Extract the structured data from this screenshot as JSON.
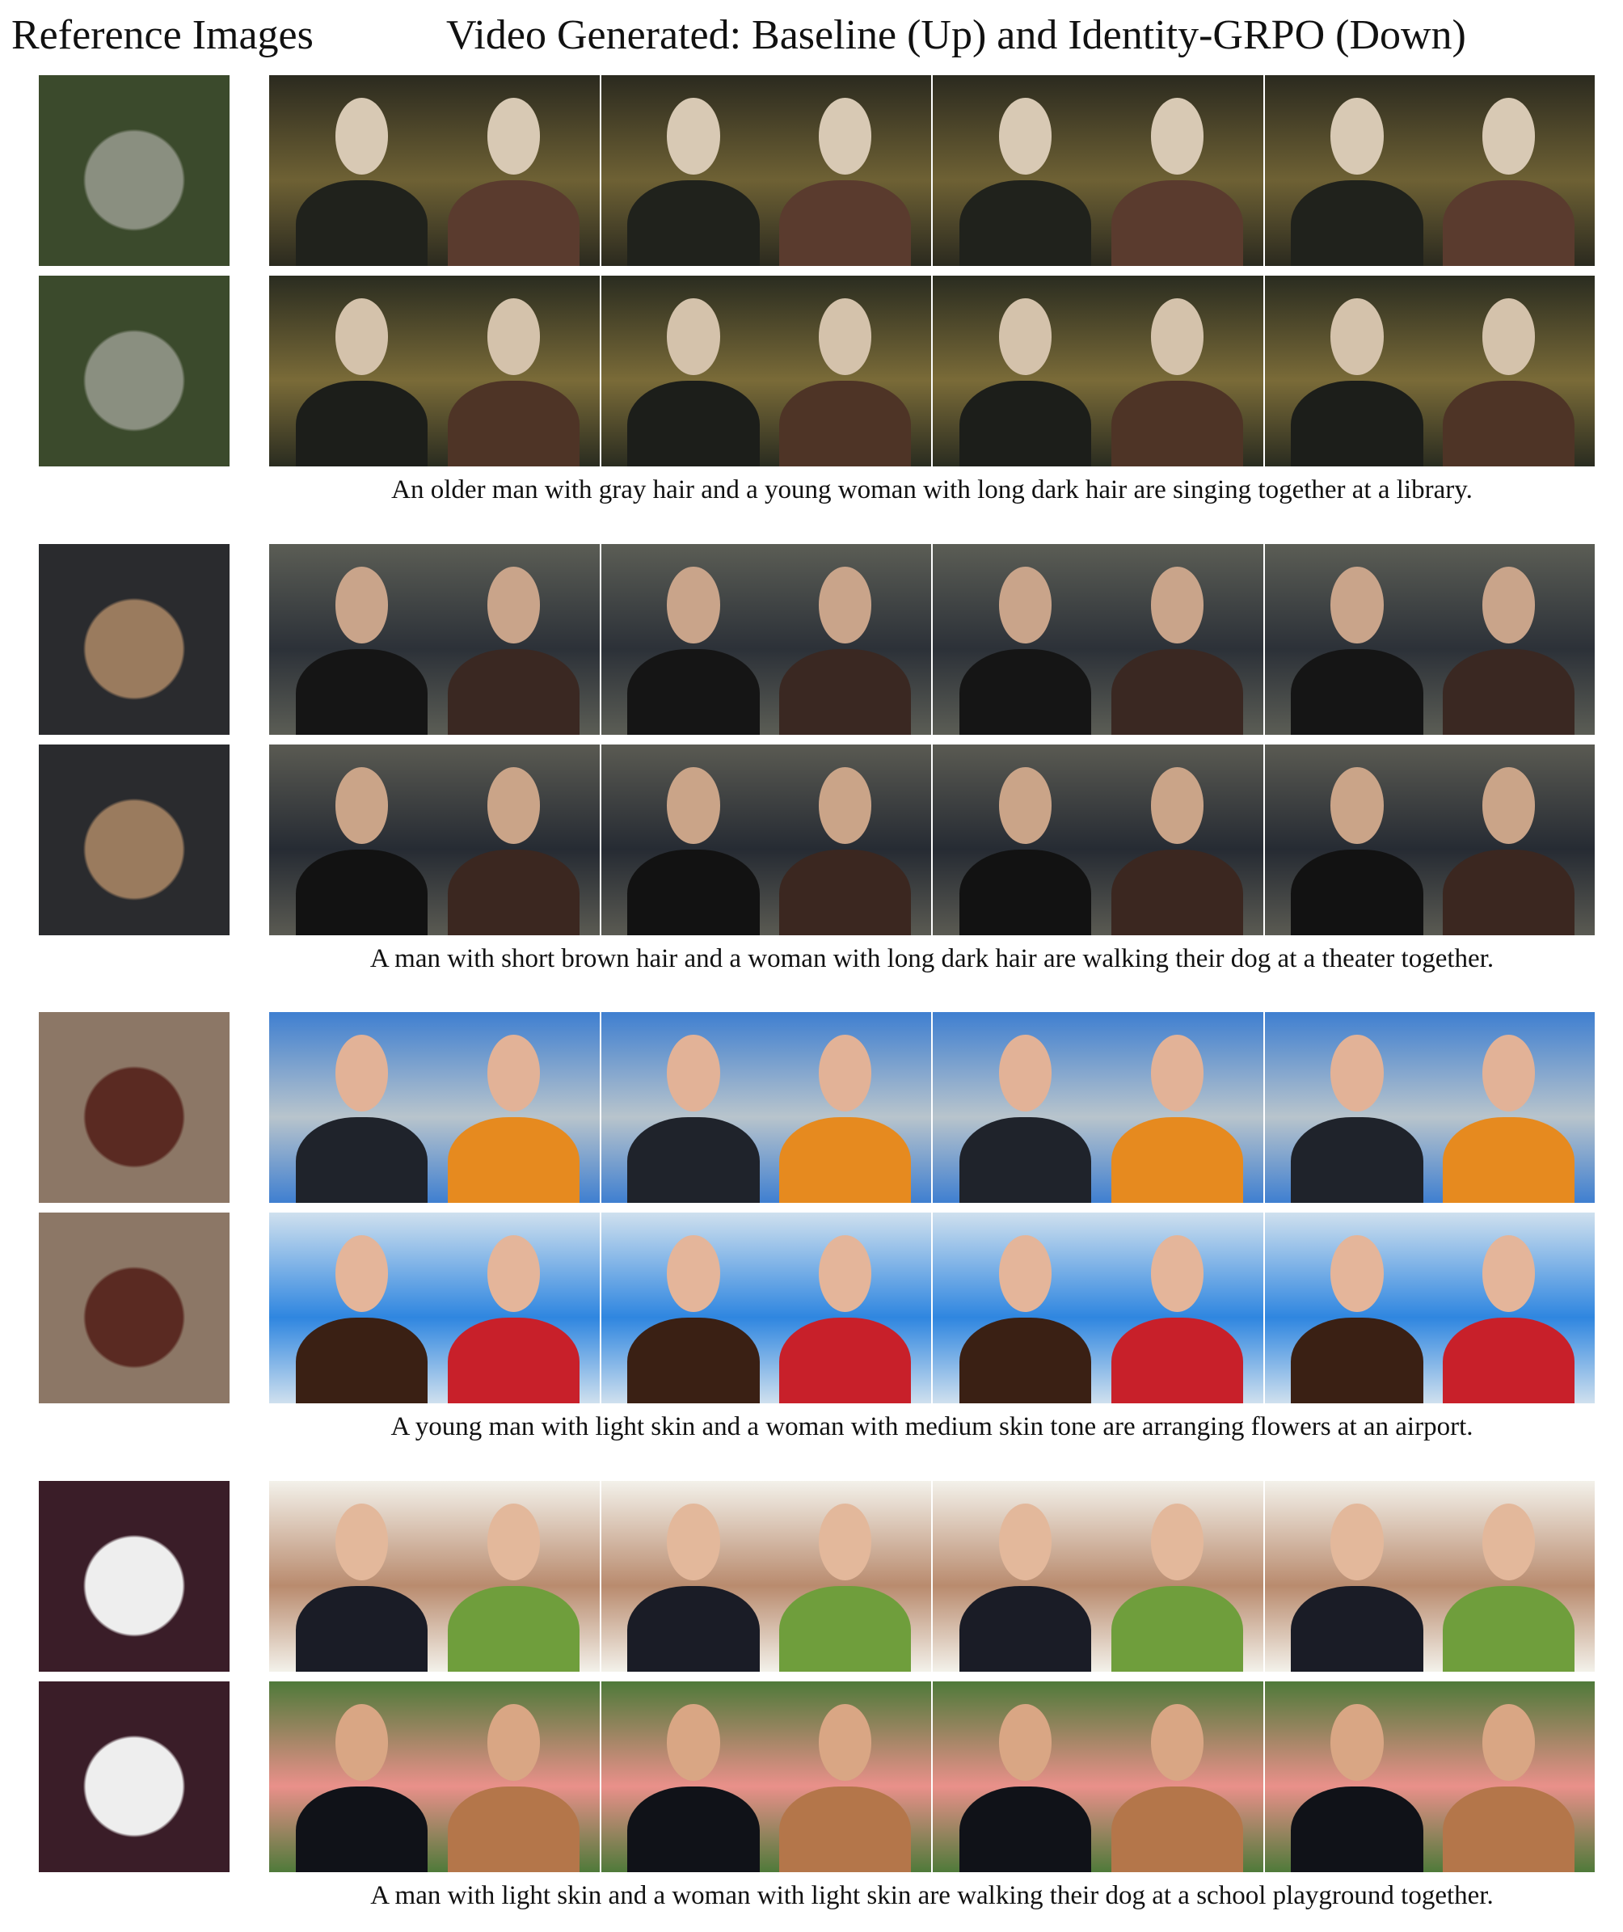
{
  "header": {
    "left": "Reference Images",
    "right": "Video Generated: Baseline (Up) and Identity-GRPO (Down)"
  },
  "groups": [
    {
      "caption": "An older man with gray hair and a young woman with long dark hair are singing together at a library.",
      "ref_colors": [
        "#3b4a2c",
        "#8a8f80"
      ],
      "row_colors": [
        [
          "#2b2a1f",
          "#6e6134",
          "#20221c",
          "#d8c9b4",
          "#5a3b2e"
        ],
        [
          "#2a2c20",
          "#7a6b38",
          "#1c1e1a",
          "#d4c2ab",
          "#4e3426"
        ]
      ]
    },
    {
      "caption": "A man with short brown hair and a woman with long dark hair are walking their dog at a theater together.",
      "ref_colors": [
        "#2a2b2e",
        "#9a7b5e"
      ],
      "row_colors": [
        [
          "#5b5d55",
          "#2c3138",
          "#151515",
          "#c9a48a",
          "#3a2822"
        ],
        [
          "#5a5a52",
          "#262b33",
          "#121212",
          "#caa488",
          "#3b2720"
        ]
      ]
    },
    {
      "caption": "A young man with light skin and a woman with medium skin tone are arranging flowers at an airport.",
      "ref_colors": [
        "#8c7766",
        "#5a2a22"
      ],
      "row_colors": [
        [
          "#3f7fd0",
          "#b8c4cc",
          "#1f232b",
          "#e2b297",
          "#e68a1f"
        ],
        [
          "#cfe0ee",
          "#2f86e0",
          "#3a2014",
          "#e4b59a",
          "#c8202a"
        ]
      ]
    },
    {
      "caption": "A man with light skin and a woman with light skin are walking their dog at a school playground together.",
      "ref_colors": [
        "#3a1d28",
        "#eeeeee"
      ],
      "row_colors": [
        [
          "#f3f1ea",
          "#b98b6e",
          "#1a1c26",
          "#e3b89b",
          "#6f9e3c"
        ],
        [
          "#4f7a3a",
          "#e9908a",
          "#101218",
          "#d9a684",
          "#b4764a"
        ]
      ]
    }
  ]
}
